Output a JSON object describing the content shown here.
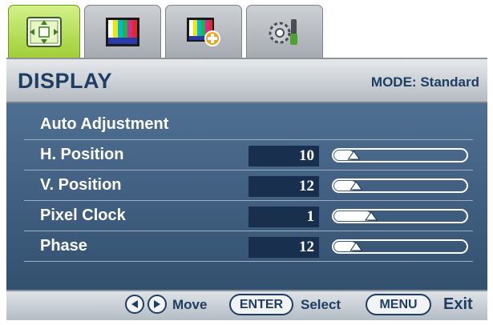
{
  "tabs": [
    {
      "icon": "display-settings-icon",
      "active": true
    },
    {
      "icon": "picture-icon",
      "active": false
    },
    {
      "icon": "picture-advanced-icon",
      "active": false
    },
    {
      "icon": "system-icon",
      "active": false
    }
  ],
  "header": {
    "title": "DISPLAY",
    "mode_label": "MODE:",
    "mode_value": "Standard"
  },
  "menu": {
    "items": [
      {
        "label": "Auto Adjustment"
      },
      {
        "label": "H. Position",
        "value": "10",
        "level": 0.1
      },
      {
        "label": "V. Position",
        "value": "12",
        "level": 0.12
      },
      {
        "label": "Pixel Clock",
        "value": "1",
        "level": 0.25
      },
      {
        "label": "Phase",
        "value": "12",
        "level": 0.12
      }
    ]
  },
  "footer": {
    "move_label": "Move",
    "enter_label": "ENTER",
    "select_label": "Select",
    "menu_label": "MENU",
    "exit_label": "Exit"
  },
  "colors": {
    "accent_tab": "#9fcf36",
    "title_text": "#1f3e63",
    "panel_bg": "#3f5e81",
    "value_box": "#18304d"
  }
}
